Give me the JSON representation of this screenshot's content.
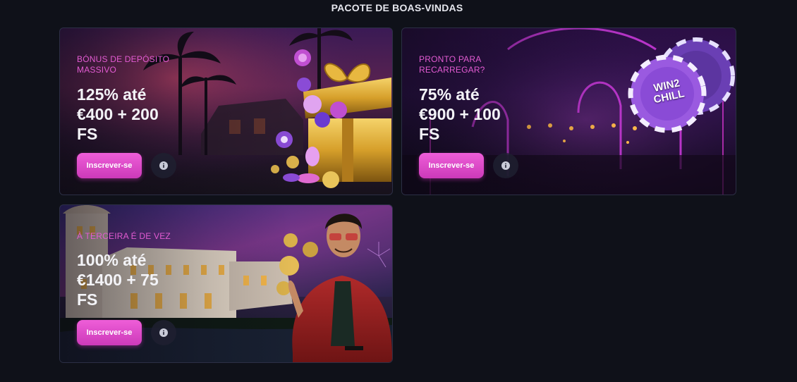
{
  "section": {
    "title": "PACOTE DE BOAS-VINDAS"
  },
  "cards": [
    {
      "eyebrow": "BÓNUS DE DEPÓSITO MASSIVO",
      "headline_line1": "125% até",
      "headline_line2": "€400 + 200",
      "headline_line3": "FS",
      "cta_label": "Inscrever-se",
      "info_icon": "info-icon"
    },
    {
      "eyebrow": "PRONTO PARA RECARREGAR?",
      "headline_line1": "75% até",
      "headline_line2": "€900 + 100",
      "headline_line3": "FS",
      "cta_label": "Inscrever-se",
      "info_icon": "info-icon",
      "chip_text_1": "WIN2",
      "chip_text_2": "CHILL"
    },
    {
      "eyebrow": "À TERCEIRA É DE VEZ",
      "headline_line1": "100% até",
      "headline_line2": "€1400 + 75",
      "headline_line3": "FS",
      "cta_label": "Inscrever-se",
      "info_icon": "info-icon"
    }
  ],
  "colors": {
    "accent": "#e25bd2",
    "cta": "#ee5ed8",
    "background": "#0f1119"
  }
}
